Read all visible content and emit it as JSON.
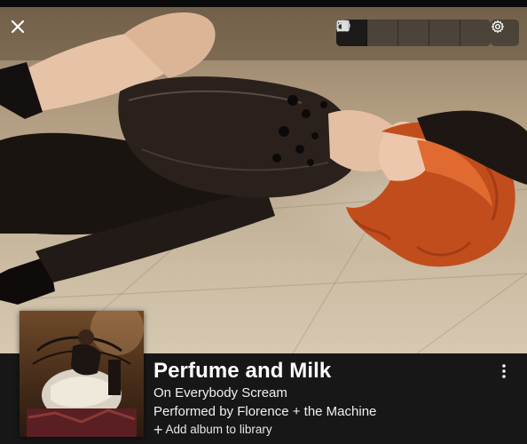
{
  "player": {
    "track_title": "Perfume and Milk",
    "album_line": "On Everybody Scream",
    "artist_line": "Performed by Florence + the Machine",
    "add_to_library_label": "Add album to library"
  },
  "toolbar": {
    "icons": [
      "close-icon",
      "person-icon",
      "album-icon",
      "lyrics-icon",
      "credits-icon",
      "info-icon",
      "gear-icon",
      "more-vertical-icon",
      "plus-icon"
    ],
    "active_view": "person-icon"
  },
  "colors": {
    "info_bar": "#171717",
    "hair_accent": "#c9501f",
    "floor": "#bfae94"
  }
}
